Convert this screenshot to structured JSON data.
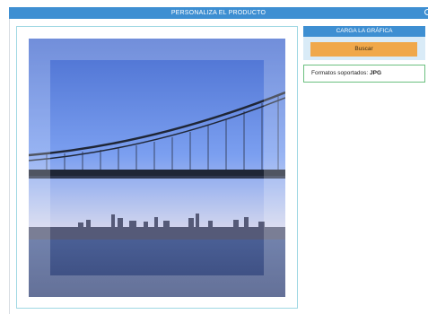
{
  "header": {
    "title": "PERSONALIZA EL PRODUCTO",
    "close_icon": "close-icon"
  },
  "upload": {
    "title": "CARGA LA GRÁFICA",
    "browse_label": "Buscar",
    "formats_label": "Formatos soportados:",
    "formats_value": "JPG"
  },
  "preview": {
    "image_description_icon": "bridge-skyline-photo"
  },
  "colors": {
    "accent_blue": "#3e8fd2",
    "button_orange": "#f0a84a",
    "formats_border": "#6cc080",
    "frame_border": "#9fd8e3"
  }
}
